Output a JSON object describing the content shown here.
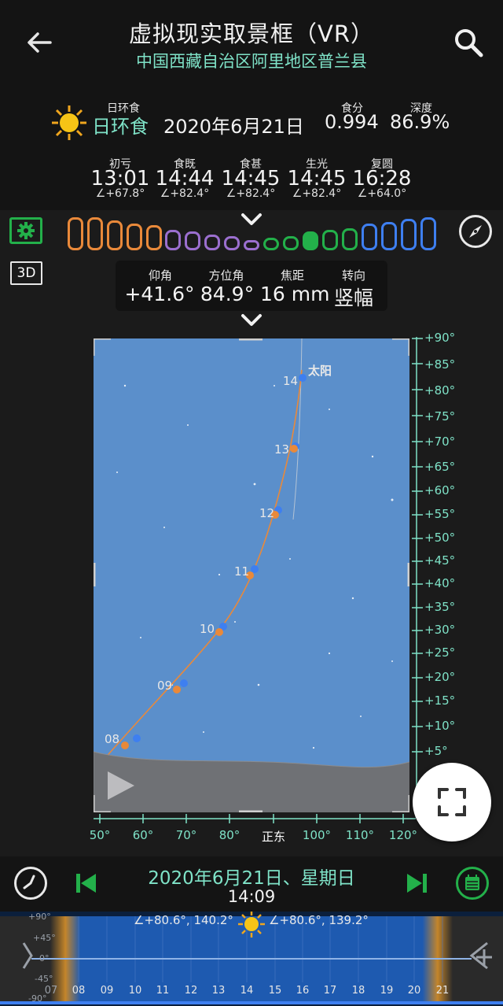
{
  "header": {
    "title": "虚拟现实取景框（VR）",
    "location": "中国西藏自治区阿里地区普兰县"
  },
  "eclipse": {
    "type_label": "日环食",
    "type_value": "日环食",
    "date": "2020年6月21日",
    "magnitude_label": "食分",
    "magnitude": "0.994",
    "obscuration_label": "深度",
    "obscuration": "86.9%"
  },
  "contacts": [
    {
      "label": "初亏",
      "time": "13:01",
      "angle": "∠+67.8°"
    },
    {
      "label": "食既",
      "time": "14:44",
      "angle": "∠+82.4°"
    },
    {
      "label": "食甚",
      "time": "14:45",
      "angle": "∠+82.4°"
    },
    {
      "label": "生光",
      "time": "14:45",
      "angle": "∠+82.4°"
    },
    {
      "label": "复圆",
      "time": "16:28",
      "angle": "∠+64.0°"
    }
  ],
  "toolbar": {
    "view_mode_3d": "3D"
  },
  "camera": {
    "altitude_label": "仰角",
    "altitude": "+41.6°",
    "azimuth_label": "方位角",
    "azimuth": "84.9°",
    "focal_label": "焦距",
    "focal": "16 mm",
    "orientation_label": "转向",
    "orientation": "竖幅"
  },
  "sky": {
    "sun_label": "太阳",
    "hour_labels": [
      "08",
      "09",
      "10",
      "11",
      "12",
      "13",
      "14"
    ],
    "altitude_ticks": [
      "+90°",
      "+85°",
      "+80°",
      "+75°",
      "+70°",
      "+65°",
      "+60°",
      "+55°",
      "+50°",
      "+45°",
      "+40°",
      "+35°",
      "+30°",
      "+25°",
      "+20°",
      "+15°",
      "+10°",
      "+5°"
    ],
    "azimuth_ticks": [
      "50°",
      "60°",
      "70°",
      "80°",
      "正东",
      "100°",
      "110°",
      "120°"
    ]
  },
  "date_bar": {
    "date": "2020年6月21日、星期日",
    "time": "14:09"
  },
  "timeline": {
    "sun_left_readout": "∠+80.6°, 140.2°",
    "sun_right_readout": "∠+80.6°, 139.2°",
    "altitude_marks": [
      "+90°",
      "+45°",
      "0°",
      "-45°",
      "-90°"
    ],
    "hours": [
      "07",
      "08",
      "09",
      "10",
      "11",
      "12",
      "13",
      "14",
      "15",
      "16",
      "17",
      "18",
      "19",
      "20",
      "21"
    ]
  },
  "colors": {
    "accent": "#7fe3c8",
    "green": "#23b04a",
    "sky": "#5b8fcb",
    "orange_track": "#e9893a",
    "blue_track": "#3e7ff0"
  }
}
